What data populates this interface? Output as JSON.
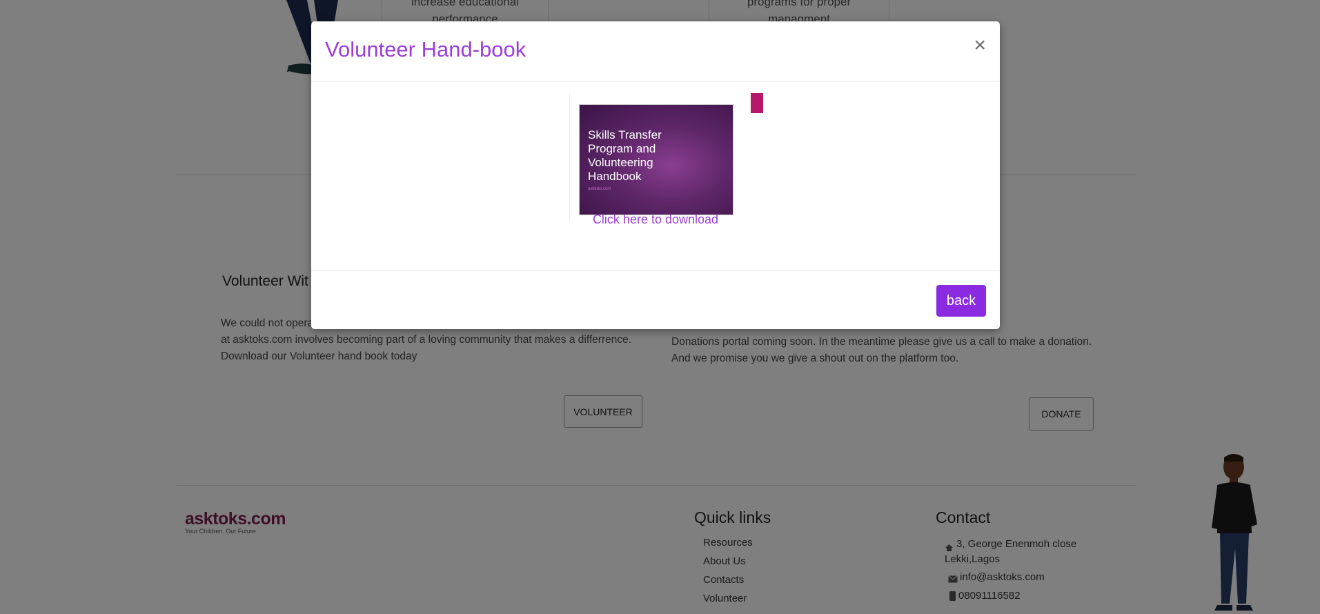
{
  "features": {
    "left_line1": "increase educational",
    "left_line2": "performance",
    "right_line1": "programs for proper",
    "right_line2": "managment"
  },
  "volunteer": {
    "title": "Volunteer Wit",
    "para_line1": "We could not opera",
    "para_line2": "at asktoks.com involves becoming part of a loving community that makes a differrence.",
    "para_line3": "Download our Volunteer hand book today",
    "button": "VOLUNTEER"
  },
  "donate": {
    "line1": "Donations portal coming soon. In the meantime please give us a call to make a donation.",
    "line2": "And we promise you we give a shout out on the platform too.",
    "button": "DONATE"
  },
  "footer": {
    "logo_brand": "asktoks.com",
    "logo_tagline": "Your Children. Our Future",
    "quick_links_title": "Quick links",
    "quick_links": [
      "Resources",
      "About Us",
      "Contacts",
      "Volunteer"
    ],
    "contact_title": "Contact",
    "address_line1": "3, George Enenmoh close",
    "address_line2": "Lekki,Lagos",
    "email": "info@asktoks.com",
    "phone": "08091116582"
  },
  "modal": {
    "title": "Volunteer Hand-book",
    "close": "×",
    "thumbnail_title_lines": [
      "Skills Transfer",
      "Program and",
      "Volunteering",
      "Handbook"
    ],
    "thumbnail_sub": "asktoks.com",
    "download_link": "Click here to download",
    "back_button": "back"
  },
  "colors": {
    "accent": "#9b3fd8",
    "button": "#8a2be2",
    "bookmark": "#b5186b"
  }
}
